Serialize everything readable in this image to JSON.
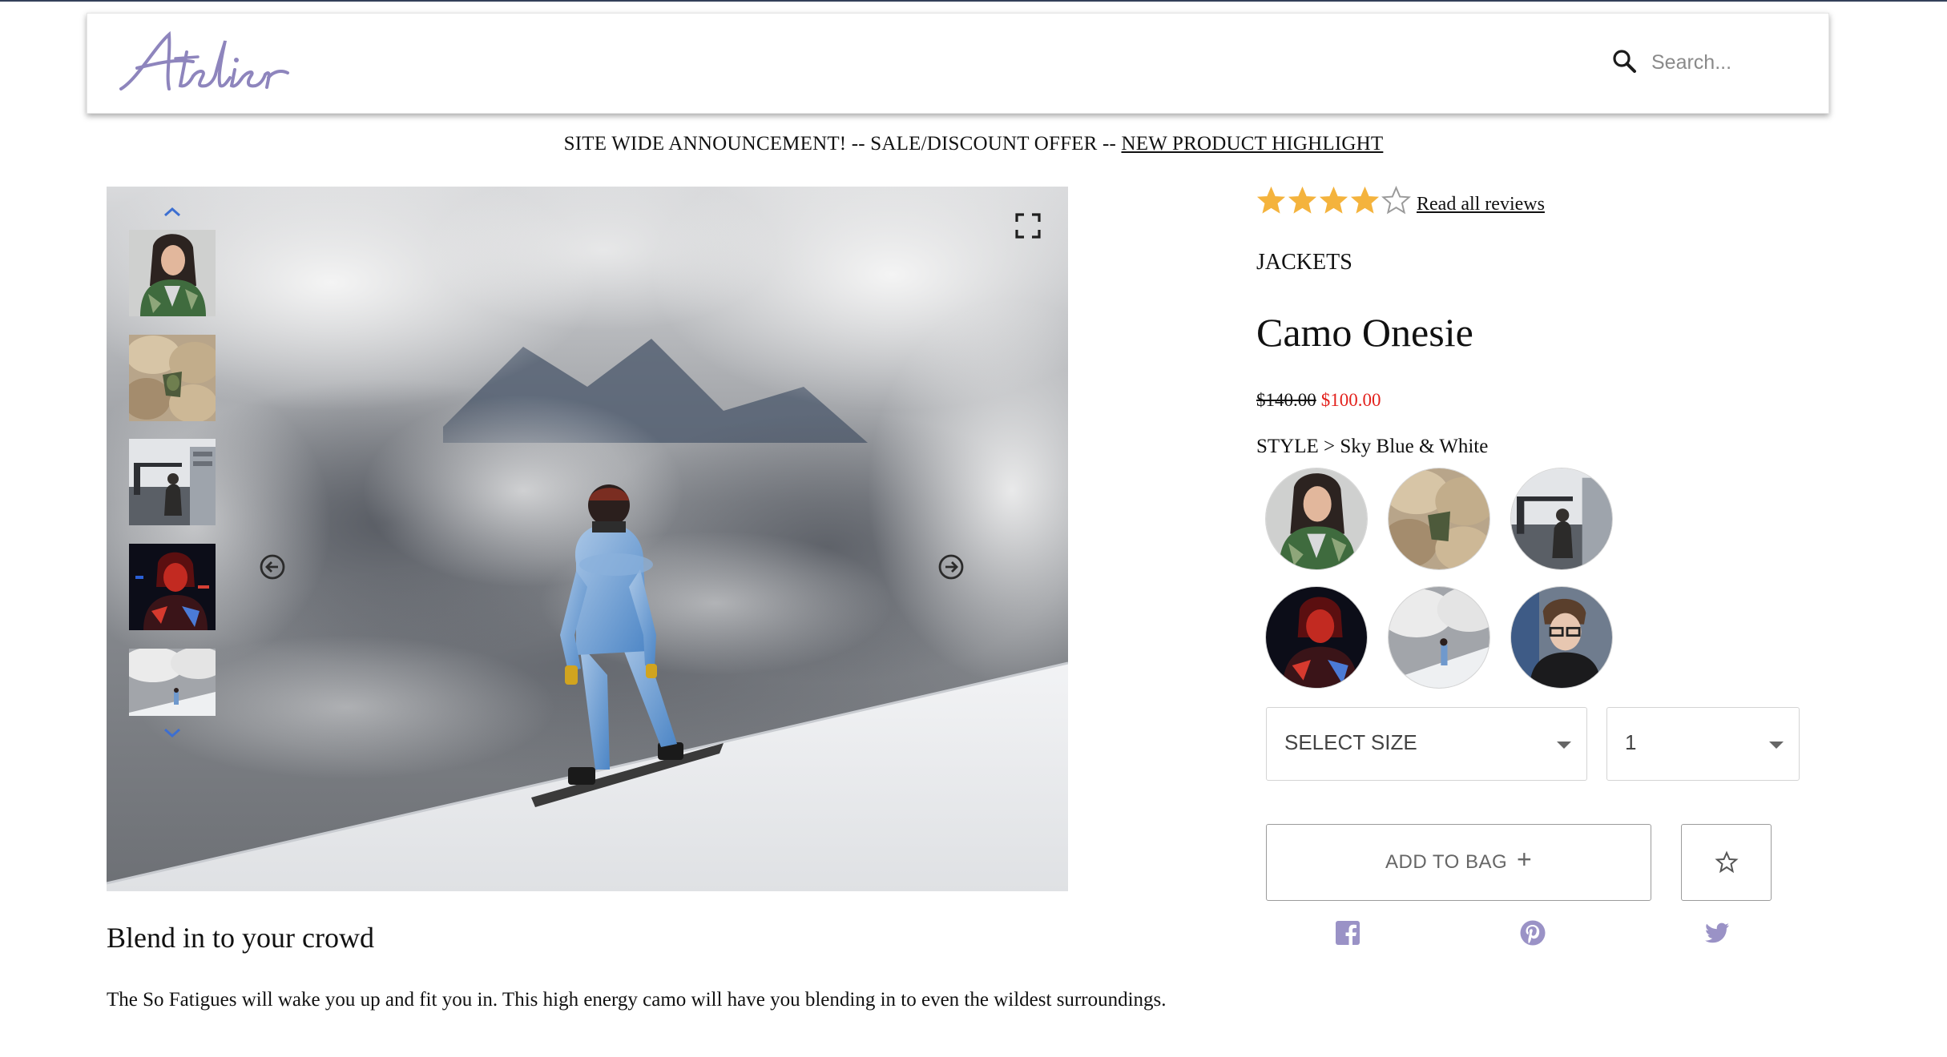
{
  "header": {
    "logo_text": "Atelier",
    "search_placeholder": "Search..."
  },
  "announcement": {
    "prefix": "SITE WIDE ANNOUNCEMENT! -- SALE/DISCOUNT OFFER -- ",
    "link": "NEW PRODUCT HIGHLIGHT"
  },
  "gallery": {
    "thumbnails": [
      "thumb-jacket-woman",
      "thumb-rocks",
      "thumb-city-crane",
      "thumb-red-portrait",
      "thumb-snowboarder"
    ],
    "icons": [
      "chevron-up-icon",
      "chevron-down-icon",
      "expand-icon",
      "arrow-left-icon",
      "arrow-right-icon"
    ]
  },
  "product": {
    "rating": 4,
    "rating_max": 5,
    "reviews_link": "Read all reviews",
    "category": "JACKETS",
    "title": "Camo Onesie",
    "original_price": "$140.00",
    "sale_price": "$100.00",
    "style_label": "STYLE > Sky Blue & White",
    "size_select": "SELECT SIZE",
    "quantity": "1",
    "add_to_bag": "ADD TO BAG",
    "add_symbol": "+"
  },
  "description": {
    "title": "Blend in to your crowd",
    "text": "The So Fatigues will wake you up and fit you in. This high energy camo will have you blending in to even the wildest surroundings."
  },
  "colors": {
    "star": "#f4b33d",
    "sale": "#e3211c",
    "logo": "#8e85bd",
    "social": "#9a92c6"
  }
}
